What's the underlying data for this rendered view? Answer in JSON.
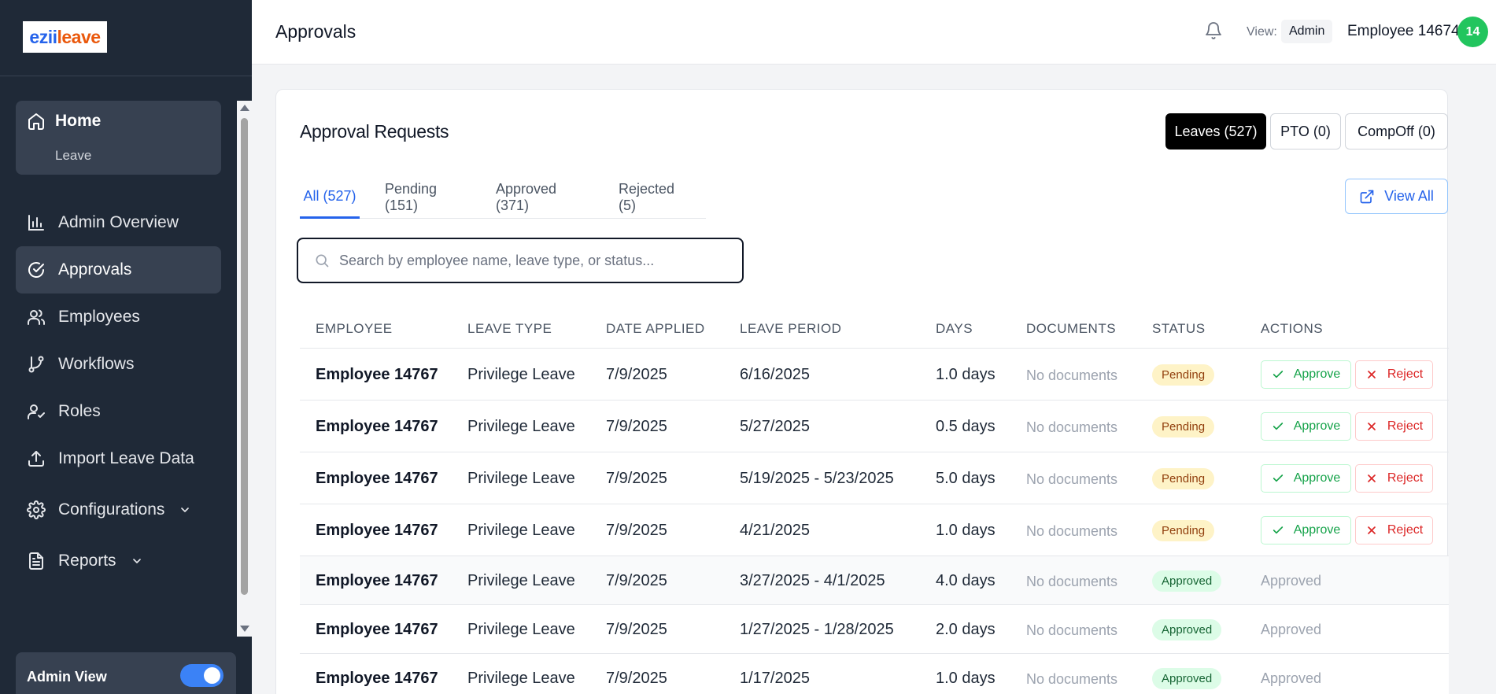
{
  "brand": {
    "logo_part1": "ezii",
    "logo_part2": "leave"
  },
  "sidebar": {
    "home": {
      "label": "Home",
      "sub_label": "Leave"
    },
    "items": [
      {
        "label": "Admin Overview",
        "icon": "bar-chart-icon"
      },
      {
        "label": "Approvals",
        "icon": "check-circle-icon",
        "active": true
      },
      {
        "label": "Employees",
        "icon": "users-icon"
      },
      {
        "label": "Workflows",
        "icon": "git-branch-icon"
      },
      {
        "label": "Roles",
        "icon": "user-check-icon"
      },
      {
        "label": "Import Leave Data",
        "icon": "upload-icon"
      },
      {
        "label": "Configurations",
        "icon": "gear-icon",
        "has_dropdown": true
      },
      {
        "label": "Reports",
        "icon": "file-text-icon",
        "has_dropdown": true
      }
    ],
    "admin_view": {
      "label": "Admin View",
      "enabled": true
    }
  },
  "header": {
    "title": "Approvals",
    "view_label": "View:",
    "view_value": "Admin",
    "user_name": "Employee 14674",
    "avatar_text": "14"
  },
  "card": {
    "title": "Approval Requests",
    "type_buttons": [
      {
        "label": "Leaves (527)",
        "active": true
      },
      {
        "label": "PTO (0)",
        "active": false
      },
      {
        "label": "CompOff (0)",
        "active": false
      }
    ],
    "tabs": [
      {
        "label": "All (527)",
        "active": true
      },
      {
        "label": "Pending (151)",
        "active": false
      },
      {
        "label": "Approved (371)",
        "active": false
      },
      {
        "label": "Rejected (5)",
        "active": false
      }
    ],
    "view_all_label": "View All",
    "search_placeholder": "Search by employee name, leave type, or status..."
  },
  "table": {
    "columns": [
      "EMPLOYEE",
      "LEAVE TYPE",
      "DATE APPLIED",
      "LEAVE PERIOD",
      "DAYS",
      "DOCUMENTS",
      "STATUS",
      "ACTIONS"
    ],
    "approve_label": "Approve",
    "reject_label": "Reject",
    "rows": [
      {
        "employee": "Employee 14767",
        "leave_type": "Privilege Leave",
        "date_applied": "7/9/2025",
        "leave_period": "6/16/2025",
        "days": "1.0 days",
        "documents": "No documents",
        "status": "Pending",
        "action_text": ""
      },
      {
        "employee": "Employee 14767",
        "leave_type": "Privilege Leave",
        "date_applied": "7/9/2025",
        "leave_period": "5/27/2025",
        "days": "0.5 days",
        "documents": "No documents",
        "status": "Pending",
        "action_text": ""
      },
      {
        "employee": "Employee 14767",
        "leave_type": "Privilege Leave",
        "date_applied": "7/9/2025",
        "leave_period": "5/19/2025 - 5/23/2025",
        "days": "5.0 days",
        "documents": "No documents",
        "status": "Pending",
        "action_text": ""
      },
      {
        "employee": "Employee 14767",
        "leave_type": "Privilege Leave",
        "date_applied": "7/9/2025",
        "leave_period": "4/21/2025",
        "days": "1.0 days",
        "documents": "No documents",
        "status": "Pending",
        "action_text": ""
      },
      {
        "employee": "Employee 14767",
        "leave_type": "Privilege Leave",
        "date_applied": "7/9/2025",
        "leave_period": "3/27/2025 - 4/1/2025",
        "days": "4.0 days",
        "documents": "No documents",
        "status": "Approved",
        "action_text": "Approved"
      },
      {
        "employee": "Employee 14767",
        "leave_type": "Privilege Leave",
        "date_applied": "7/9/2025",
        "leave_period": "1/27/2025 - 1/28/2025",
        "days": "2.0 days",
        "documents": "No documents",
        "status": "Approved",
        "action_text": "Approved"
      },
      {
        "employee": "Employee 14767",
        "leave_type": "Privilege Leave",
        "date_applied": "7/9/2025",
        "leave_period": "1/17/2025",
        "days": "1.0 days",
        "documents": "No documents",
        "status": "Approved",
        "action_text": "Approved"
      }
    ]
  },
  "colors": {
    "sidebar_bg": "#1f2937",
    "accent": "#2563eb",
    "pending_bg": "#fef3c7",
    "approved_bg": "#dcfce7",
    "avatar_bg": "#22c55e"
  }
}
